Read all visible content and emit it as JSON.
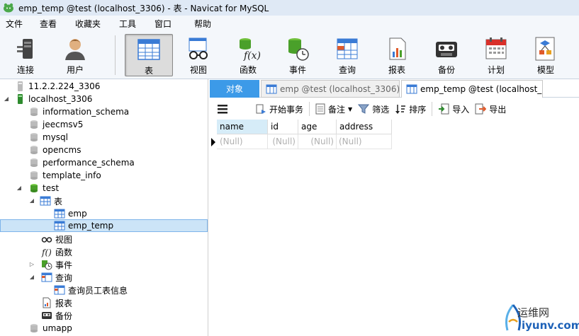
{
  "window": {
    "title": "emp_temp @test (localhost_3306) - 表 - Navicat for MySQL"
  },
  "menu": [
    "文件",
    "查看",
    "收藏夹",
    "工具",
    "窗口",
    "帮助"
  ],
  "toolbar": {
    "connect": "连接",
    "user": "用户",
    "table": "表",
    "view": "视图",
    "function": "函数",
    "event": "事件",
    "query": "查询",
    "report": "报表",
    "backup": "备份",
    "schedule": "计划",
    "model": "模型"
  },
  "tree": {
    "conn1": "11.2.2.224_3306",
    "conn2": "localhost_3306",
    "dbs": [
      "information_schema",
      "jeecmsv5",
      "mysql",
      "opencms",
      "performance_schema",
      "template_info"
    ],
    "test": "test",
    "tables_group": "表",
    "tables": [
      "emp",
      "emp_temp"
    ],
    "views": "视图",
    "functions": "函数",
    "events": "事件",
    "queries": "查询",
    "query_item": "查询员工表信息",
    "reports": "报表",
    "backups": "备份",
    "umapp": "umapp"
  },
  "tabs": {
    "objects": "对象",
    "tab1": "emp @test (localhost_3306)...",
    "tab2": "emp_temp @test (localhost_..."
  },
  "subtoolbar": {
    "begin_tx": "开始事务",
    "note": "备注",
    "filter": "筛选",
    "sort": "排序",
    "import": "导入",
    "export": "导出"
  },
  "grid": {
    "columns": [
      "name",
      "id",
      "age",
      "address"
    ],
    "row": [
      "(Null)",
      "(Null)",
      "(Null)",
      "(Null)"
    ]
  },
  "watermark": {
    "cn": "运维网",
    "en": "iyunv.com"
  },
  "colors": {
    "accent": "#3c9ae8",
    "selection": "#cce4f7",
    "titlebar": "#dfe9f5"
  }
}
